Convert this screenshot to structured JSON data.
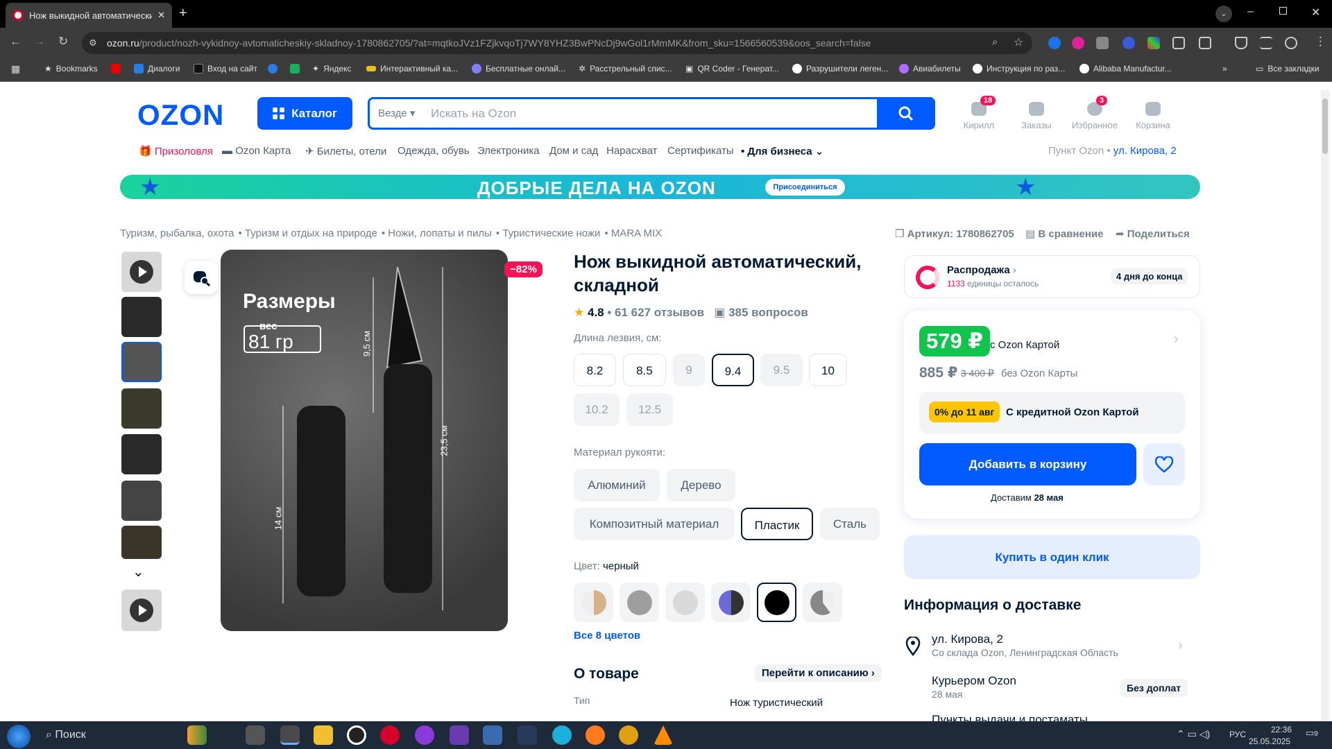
{
  "browser": {
    "tab_title": "Нож выкидной автоматический, ...",
    "url_host": "ozon.ru",
    "url_path": "/product/nozh-vykidnoy-avtomaticheskiy-skladnoy-1780862705/?at=mqtkoJVz1FZjkvqoTj7WY8YHZ3BwPNcDj9wGol1rMmMK&from_sku=1566560539&oos_search=false",
    "bookmarks": [
      "Bookmarks",
      "Диалоги",
      "Вход на сайт",
      "Яндекс",
      "Интерактивный ка...",
      "Бесплатные онлай...",
      "Расстрельный спис...",
      "QR Coder - Генерат...",
      "Разрушители леген...",
      "Авиабилеты",
      "Инструкция по раз...",
      "Alibaba Manufactur..."
    ],
    "all_bookmarks": "Все закладки"
  },
  "header": {
    "logo": "OZON",
    "catalog": "Каталог",
    "search_scope": "Везде",
    "search_placeholder": "Искать на Ozon",
    "icons": [
      {
        "label": "Кирилл",
        "badge": "18"
      },
      {
        "label": "Заказы",
        "badge": ""
      },
      {
        "label": "Избранное",
        "badge": "3"
      },
      {
        "label": "Корзина",
        "badge": ""
      }
    ]
  },
  "nav": {
    "items": [
      "Призоловля",
      "Ozon Карта",
      "Билеты, отели",
      "Одежда, обувь",
      "Электроника",
      "Дом и сад",
      "Нарасхват",
      "Сертификаты",
      "Для бизнеса"
    ],
    "pickup_label": "Пункт Ozon",
    "pickup_address": "ул. Кирова, 2"
  },
  "banner": {
    "text": "ДОБРЫЕ ДЕЛА НА OZON",
    "button": "Присоединиться"
  },
  "breadcrumbs": [
    "Туризм, рыбалка, охота",
    "Туризм и отдых на природе",
    "Ножи, лопаты и пилы",
    "Туристические ножи",
    "MARA MIX"
  ],
  "actions": {
    "article": "Артикул: 1780862705",
    "compare": "В сравнение",
    "share": "Поделиться"
  },
  "gallery": {
    "discount": "−82%",
    "overlay_title": "Размеры",
    "overlay_weight_label": "вес",
    "overlay_weight": "81 гр",
    "dim1": "9,5 см",
    "dim2": "23,5 см",
    "dim3": "14 см"
  },
  "product": {
    "title": "Нож выкидной автоматический, складной",
    "rating": "4.8",
    "reviews": "61 627 отзывов",
    "questions": "385 вопросов",
    "blade_label": "Длина лезвия, см:",
    "blade_options": [
      "8.2",
      "8.5",
      "9",
      "9.4",
      "9.5",
      "10",
      "10.2",
      "12.5"
    ],
    "handle_label": "Материал рукояти:",
    "handle_options": [
      "Алюминий",
      "Дерево",
      "Композитный материал",
      "Пластик",
      "Сталь"
    ],
    "color_label": "Цвет:",
    "color_value": "черный",
    "all_colors": "Все 8 цветов",
    "about": "О товаре",
    "go_desc": "Перейти к описанию",
    "spec_key": "Тип",
    "spec_val": "Нож туристический"
  },
  "sale": {
    "title": "Распродажа",
    "remaining_count": "1133",
    "remaining_text": " единицы осталось",
    "ends": "4 дня до конца"
  },
  "price": {
    "card_price": "579 ₽",
    "card_label": "с Ozon Картой",
    "price": "885 ₽",
    "old_price": "3 400 ₽",
    "no_card_label": "без Ozon Карты",
    "credit_badge": "0% до 11 авг",
    "credit_text": "С кредитной Ozon Картой",
    "add_to_cart": "Добавить в корзину",
    "delivery": "Доставим",
    "delivery_date": "28 мая",
    "one_click": "Купить в один клик"
  },
  "delivery": {
    "title": "Информация о доставке",
    "address": "ул. Кирова, 2",
    "warehouse": "Со склада Ozon, Ленинградская Область",
    "courier": "Курьером Ozon",
    "courier_date": "28 мая",
    "courier_price": "Без доплат",
    "pickup": "Пункты выдачи и постаматы"
  },
  "taskbar": {
    "search": "Поиск",
    "lang": "РУС",
    "time": "22:36",
    "date": "25.05.2025",
    "notif": "9"
  }
}
